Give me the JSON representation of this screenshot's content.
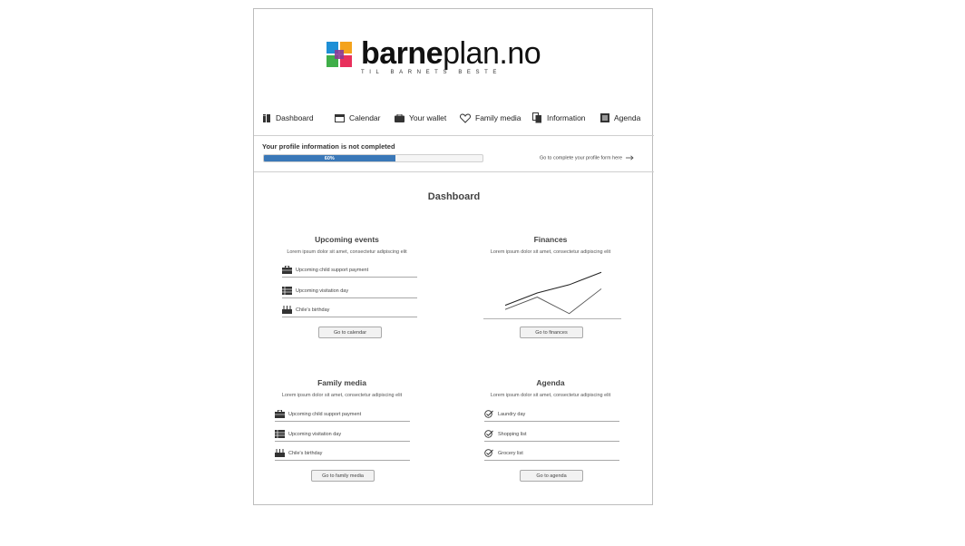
{
  "brand": {
    "name_bold": "barne",
    "name_rest": "plan.no",
    "tagline": "TIL BARNETS BESTE",
    "colors": [
      "#f4a31c",
      "#e8305c",
      "#1e8fd6",
      "#3fae49",
      "#8a3b96"
    ]
  },
  "nav": {
    "items": [
      {
        "label": "Dashboard",
        "icon": "dashboard-icon"
      },
      {
        "label": "Calendar",
        "icon": "calendar-icon"
      },
      {
        "label": "Your wallet",
        "icon": "wallet-icon"
      },
      {
        "label": "Family media",
        "icon": "heart-icon"
      },
      {
        "label": "Information",
        "icon": "documents-icon"
      },
      {
        "label": "Agenda",
        "icon": "list-icon"
      }
    ]
  },
  "profile": {
    "warning": "Your profile information is not completed",
    "progress_label": "60%",
    "progress_value": 0.6,
    "progress_color": "#3a78b8",
    "complete_link": "Go to complete your profile form here",
    "arrow_icon": "arrow-right-icon"
  },
  "dashboard": {
    "title": "Dashboard",
    "upcoming": {
      "title": "Upcoming events",
      "subtitle": "Lorem ipsum dolor sit amet, consectetur adipiscing elit",
      "rows": [
        {
          "label": "Upcoming child support payment",
          "icon": "briefcase-icon"
        },
        {
          "label": "Upcoming visitation day",
          "icon": "schedule-icon"
        },
        {
          "label": "Chile's birthday",
          "icon": "cake-icon"
        }
      ],
      "button": "Go to calendar"
    },
    "finances": {
      "title": "Finances",
      "subtitle": "Lorem ipsum dolor sit amet, consectetur adipiscing elit",
      "button": "Go to finances",
      "chart_data": {
        "type": "line",
        "x": [
          0,
          1,
          2,
          3
        ],
        "series": [
          {
            "values": [
              1,
              4,
              6,
              9
            ]
          },
          {
            "values": [
              0,
              3,
              -1,
              5
            ]
          }
        ],
        "ylim": [
          -1.5,
          9.5
        ],
        "grid": false
      }
    },
    "family_media": {
      "title": "Family media",
      "subtitle": "Lorem ipsum dolor sit amet, consectetur adipiscing elit",
      "rows": [
        {
          "label": "Upcoming child support payment",
          "icon": "briefcase-icon"
        },
        {
          "label": "Upcoming visitation day",
          "icon": "schedule-icon"
        },
        {
          "label": "Chile's birthday",
          "icon": "cake-icon"
        }
      ],
      "button": "Go to family media"
    },
    "agenda": {
      "title": "Agenda",
      "subtitle": "Lorem ipsum dolor sit amet, consectetur adipiscing elit",
      "rows": [
        {
          "label": "Laundry day",
          "icon": "check-circle-icon"
        },
        {
          "label": "Shopping list",
          "icon": "check-circle-icon"
        },
        {
          "label": "Grocery list",
          "icon": "check-circle-icon"
        }
      ],
      "button": "Go to agenda"
    }
  }
}
